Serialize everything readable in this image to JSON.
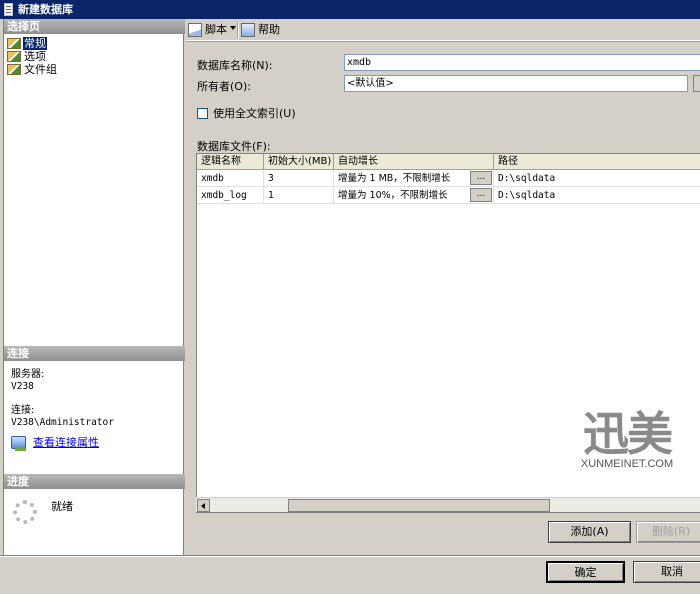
{
  "window": {
    "title": "新建数据库"
  },
  "left": {
    "select_page_header": "选择页",
    "nav_items": [
      {
        "label": "常规",
        "active": true
      },
      {
        "label": "选项",
        "active": false
      },
      {
        "label": "文件组",
        "active": false
      }
    ],
    "connection_header": "连接",
    "server_label": "服务器:",
    "server_value": "V238",
    "connection_label": "连接:",
    "connection_value": "V238\\Administrator",
    "view_connection_link": "查看连接属性",
    "progress_header": "进度",
    "progress_status": "就绪"
  },
  "toolbar": {
    "script_label": "脚本",
    "help_label": "帮助"
  },
  "form": {
    "db_name_label": "数据库名称(N):",
    "db_name_value": "xmdb",
    "owner_label": "所有者(O):",
    "owner_value": "<默认值>",
    "fulltext_label": "使用全文索引(U)",
    "fulltext_checked": false,
    "files_label": "数据库文件(F):"
  },
  "files_table": {
    "columns": [
      "逻辑名称",
      "初始大小(MB)",
      "自动增长",
      "路径"
    ],
    "rows": [
      {
        "name": "xmdb",
        "size": "3",
        "growth": "增量为 1 MB，不限制增长",
        "path": "D:\\sqldata"
      },
      {
        "name": "xmdb_log",
        "size": "1",
        "growth": "增量为 10%，不限制增长",
        "path": "D:\\sqldata"
      }
    ],
    "ellipsis": "..."
  },
  "buttons": {
    "add": "添加(A)",
    "remove": "删除(R)",
    "ok": "确定",
    "cancel": "取消"
  },
  "watermark": {
    "logo": "迅美",
    "text": "XUNMEINET.COM"
  }
}
